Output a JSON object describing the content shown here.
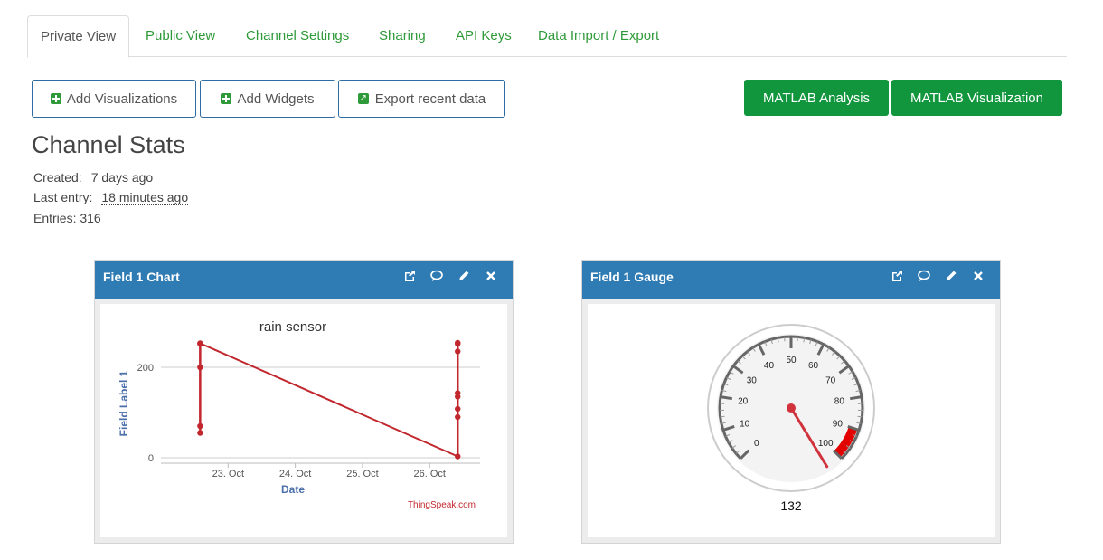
{
  "tabs": [
    {
      "label": "Private View"
    },
    {
      "label": "Public View"
    },
    {
      "label": "Channel Settings"
    },
    {
      "label": "Sharing"
    },
    {
      "label": "API Keys"
    },
    {
      "label": "Data Import / Export"
    }
  ],
  "toolbar": {
    "add_visualizations": "Add Visualizations",
    "add_widgets": "Add Widgets",
    "export_recent": "Export recent data",
    "matlab_analysis": "MATLAB Analysis",
    "matlab_visualization": "MATLAB Visualization"
  },
  "stats": {
    "title": "Channel Stats",
    "created_label": "Created:",
    "created_value": "7 days ago",
    "last_entry_label": "Last entry:",
    "last_entry_value": "18 minutes ago",
    "entries": "Entries: 316"
  },
  "colors": {
    "accent": "#11963e",
    "panel_header": "#2f7bb4",
    "line": "#c1272d"
  },
  "chart_panel": {
    "title": "Field 1 Chart",
    "credit": "ThingSpeak.com",
    "chart_data": {
      "type": "line",
      "title": "rain sensor",
      "xlabel": "Date",
      "ylabel": "Field Label 1",
      "xticks": [
        "23. Oct",
        "24. Oct",
        "25. Oct",
        "26. Oct"
      ],
      "yticks": [
        "0",
        "200"
      ],
      "ylim": [
        0,
        260
      ],
      "grid": true,
      "series": [
        {
          "points": [
            {
              "x": "2021-10-22T14:00",
              "y": 55
            },
            {
              "x": "2021-10-22T14:00",
              "y": 70
            },
            {
              "x": "2021-10-22T14:00",
              "y": 200
            },
            {
              "x": "2021-10-22T14:00",
              "y": 252
            },
            {
              "x": "2021-10-22T14:00",
              "y": 253
            },
            {
              "x": "2021-10-26T10:00",
              "y": 3
            },
            {
              "x": "2021-10-26T10:00",
              "y": 90
            },
            {
              "x": "2021-10-26T10:00",
              "y": 108
            },
            {
              "x": "2021-10-26T10:00",
              "y": 135
            },
            {
              "x": "2021-10-26T10:00",
              "y": 143
            },
            {
              "x": "2021-10-26T10:00",
              "y": 235
            },
            {
              "x": "2021-10-26T10:00",
              "y": 252
            },
            {
              "x": "2021-10-26T10:00",
              "y": 254
            }
          ]
        }
      ]
    }
  },
  "gauge_panel": {
    "title": "Field 1 Gauge",
    "value": "132",
    "value_num": 132,
    "min": 0,
    "max": 100,
    "ticks": [
      "0",
      "10",
      "20",
      "30",
      "40",
      "50",
      "60",
      "70",
      "80",
      "90",
      "100"
    ],
    "danger_from": 90
  }
}
